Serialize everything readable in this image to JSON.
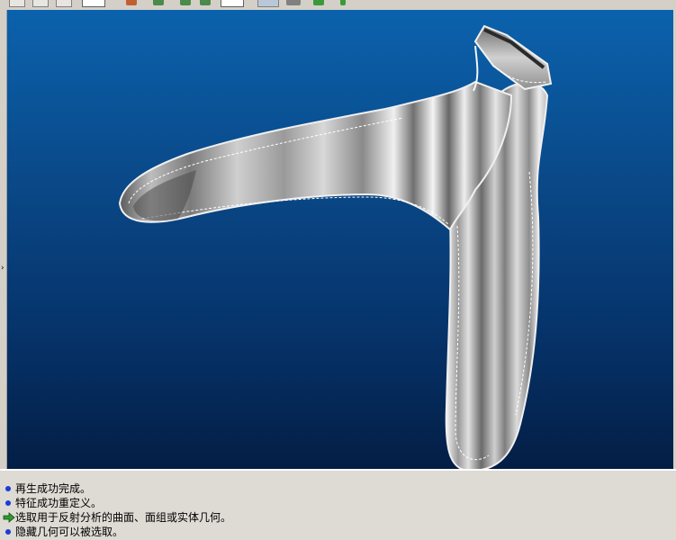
{
  "viewport": {
    "model_name": "reflection-analysis-shell-model",
    "background_top": "#0b62ad",
    "background_bottom": "#031e45"
  },
  "messages": [
    {
      "type": "info",
      "text": "再生成功完成。"
    },
    {
      "type": "info",
      "text": "特征成功重定义。"
    },
    {
      "type": "prompt",
      "text": "选取用于反射分析的曲面、面组或实体几何。"
    },
    {
      "type": "info",
      "text": "隐藏几何可以被选取。"
    }
  ],
  "colors": {
    "bullet": "#1b3ad6",
    "prompt_arrow": "#2e9a2e"
  }
}
